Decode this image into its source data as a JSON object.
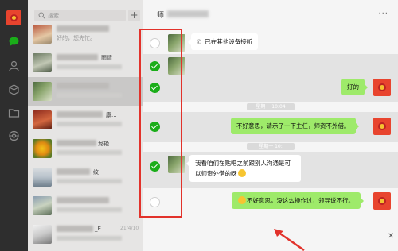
{
  "search": {
    "placeholder": "搜索"
  },
  "list": {
    "items": [
      {
        "name_tail": "",
        "preview": "好的，您先忙。",
        "time": ""
      },
      {
        "name_tail": "雨倩",
        "preview": "",
        "time": ""
      },
      {
        "name_tail": "",
        "preview": "",
        "time": ""
      },
      {
        "name_tail": "康...",
        "preview": "",
        "time": ""
      },
      {
        "name_tail": "龙艳",
        "preview": "",
        "time": ""
      },
      {
        "name_tail": "纹",
        "preview": "",
        "time": ""
      },
      {
        "name_tail": "",
        "preview": "",
        "time": ""
      },
      {
        "name_tail": "_E...",
        "preview": "",
        "time": "21/4/10"
      }
    ]
  },
  "chat": {
    "title": "师",
    "menu": "···",
    "messages": [
      {
        "text": "已在其他设备接听"
      },
      {
        "text": "好的"
      },
      {
        "time": "星期一 10:04"
      },
      {
        "text": "不好意思，请示了一下主任，师资不外借。"
      },
      {
        "time": "星期一 10:"
      },
      {
        "text": "我看咱们在贴吧之前跟别人沟通是可以师资外借的呀"
      },
      {
        "text": "不好意思，没这么操作过，领导说不行。"
      }
    ],
    "close": "✕"
  },
  "colors": {
    "accent": "#1aad19",
    "bubble_green": "#9eea6a",
    "highlight": "#e2322b"
  }
}
